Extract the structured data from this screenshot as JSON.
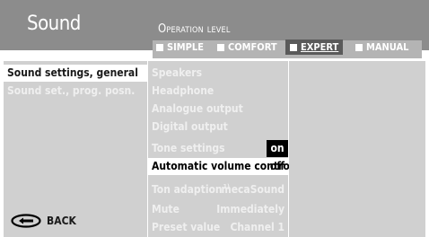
{
  "header": {
    "title": "Sound",
    "operation_level": "Operation level"
  },
  "levels": [
    {
      "label": "SIMPLE"
    },
    {
      "label": "COMFORT"
    },
    {
      "label": "EXPERT"
    },
    {
      "label": "MANUAL"
    }
  ],
  "left_menu": [
    "Sound settings, general",
    "Sound set., prog. posn."
  ],
  "middle_menu": {
    "items": [
      "Speakers",
      "Headphone",
      "Analogue output",
      "Digital output"
    ],
    "tone_settings": {
      "label": "Tone settings",
      "value": "on"
    },
    "avc": {
      "label": "Automatic volume control",
      "value": "off"
    },
    "ton_adaption": {
      "label": "Ton adaption",
      "footnote": "1)",
      "value": "mecaSound"
    },
    "mute": {
      "label": "Mute",
      "value": "Immediately"
    },
    "preset": {
      "label": "Preset value",
      "value": "Channel 1"
    }
  },
  "back": {
    "label": "BACK",
    "icon": "back-arrow-icon"
  },
  "colors": {
    "header": "#8c8c8c",
    "panel": "#d0d0d0",
    "selected_level": "#5a5a5a",
    "highlight": "#ffffff",
    "badge": "#000000"
  }
}
